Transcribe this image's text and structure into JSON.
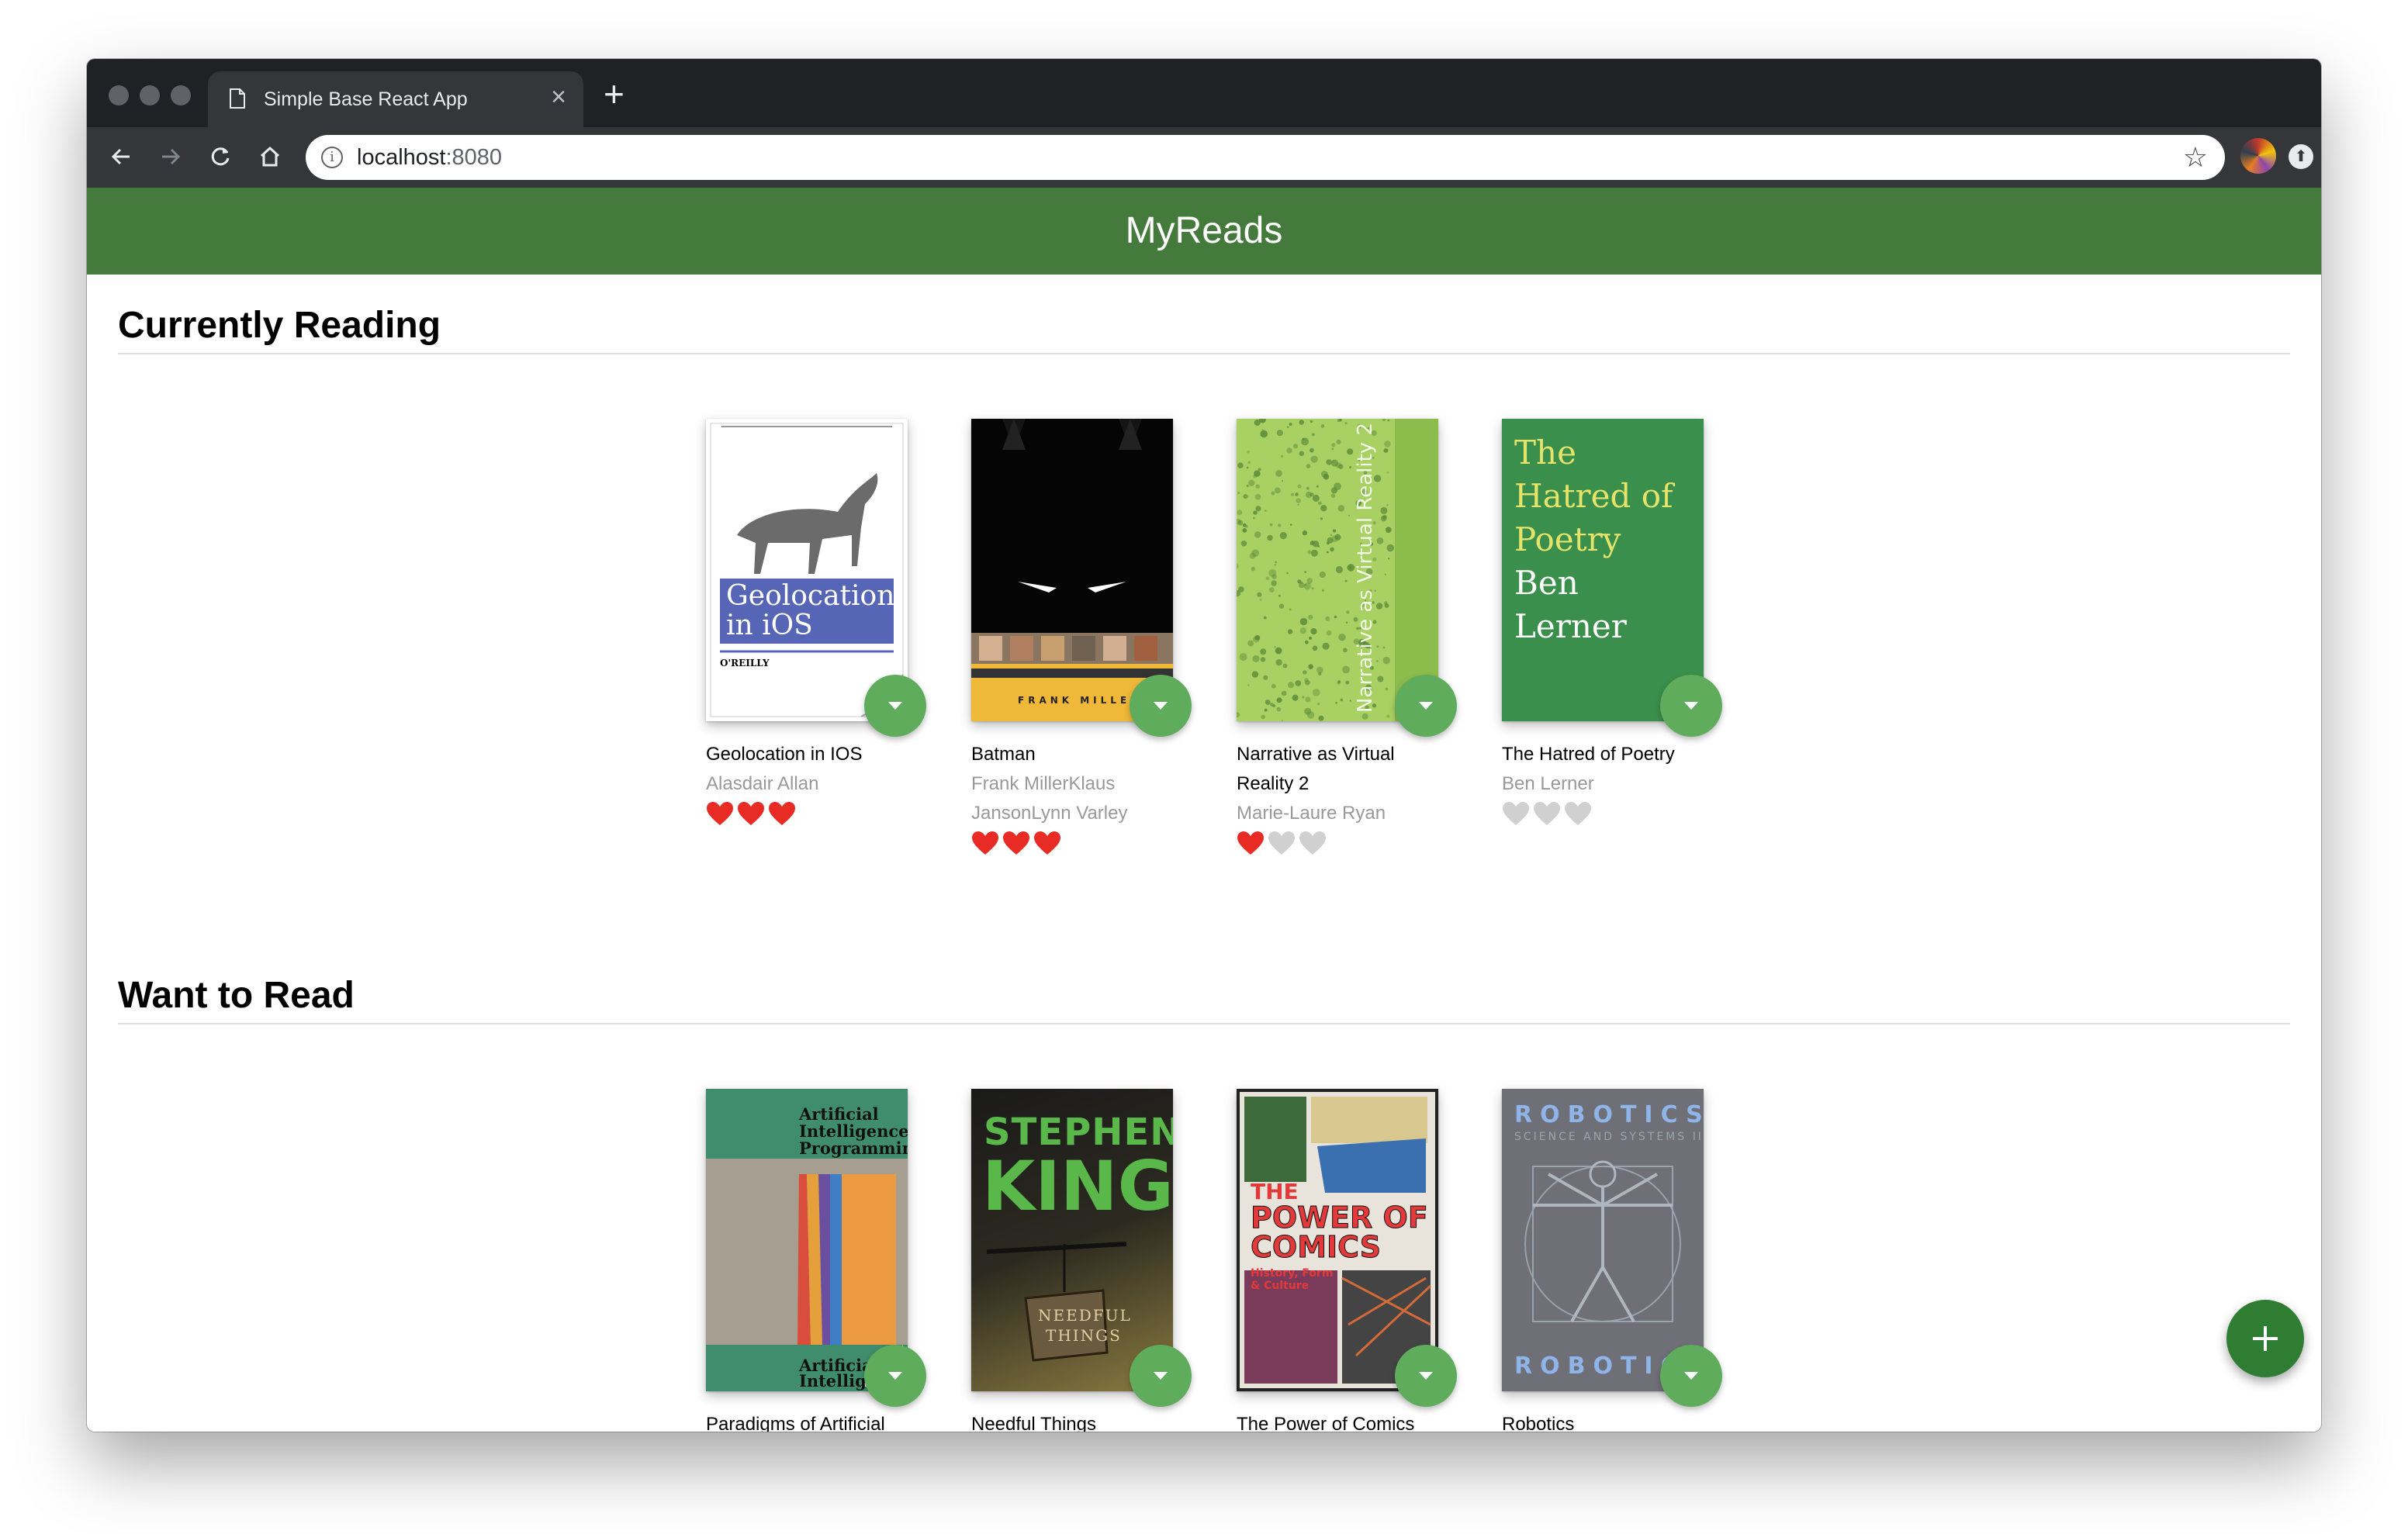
{
  "browser": {
    "tab_title": "Simple Base React App",
    "url_host": "localhost",
    "url_port": ":8080"
  },
  "app": {
    "title": "MyReads"
  },
  "colors": {
    "header": "#447a3b",
    "changer": "#60ac5d",
    "heart_on": "#e82b24",
    "heart_off": "#d0d0d0",
    "fab": "#2e7d32"
  },
  "shelves": [
    {
      "title": "Currently Reading",
      "books": [
        {
          "title_lines": [
            "Geolocation in IOS"
          ],
          "author_lines": [
            "Alasdair Allan"
          ],
          "rating": 3,
          "cover_text": [
            "Geolocation",
            "in iOS",
            "O'REILLY"
          ]
        },
        {
          "title_lines": [
            "Batman"
          ],
          "author_lines": [
            "Frank MillerKlaus",
            "JansonLynn Varley"
          ],
          "rating": 3,
          "cover_text": [
            "FRANK MILLER"
          ]
        },
        {
          "title_lines": [
            "Narrative as Virtual",
            "Reality 2"
          ],
          "author_lines": [
            "Marie-Laure Ryan"
          ],
          "rating": 1,
          "cover_text": [
            "Narrative as Virtual Reality 2"
          ]
        },
        {
          "title_lines": [
            "The Hatred of Poetry"
          ],
          "author_lines": [
            "Ben Lerner"
          ],
          "rating": 0,
          "cover_text": [
            "The",
            "Hatred of",
            "Poetry",
            "Ben",
            "Lerner"
          ]
        }
      ]
    },
    {
      "title": "Want to Read",
      "books": [
        {
          "title_lines": [
            "Paradigms of Artificial"
          ],
          "author_lines": [],
          "rating": null,
          "cover_text": [
            "Artificial",
            "Intelligence",
            "Programming:",
            "Artificial",
            "Intelligen"
          ]
        },
        {
          "title_lines": [
            "Needful Things"
          ],
          "author_lines": [],
          "rating": null,
          "cover_text": [
            "STEPHEN",
            "KING",
            "NEEDFUL",
            "THINGS"
          ]
        },
        {
          "title_lines": [
            "The Power of Comics"
          ],
          "author_lines": [],
          "rating": null,
          "cover_text": [
            "THE",
            "POWER OF",
            "COMICS",
            "History, Form & Culture"
          ]
        },
        {
          "title_lines": [
            "Robotics"
          ],
          "author_lines": [],
          "rating": null,
          "cover_text": [
            "ROBOTICS",
            "SCIENCE AND SYSTEMS II",
            "ROBOTIC"
          ]
        }
      ]
    }
  ]
}
